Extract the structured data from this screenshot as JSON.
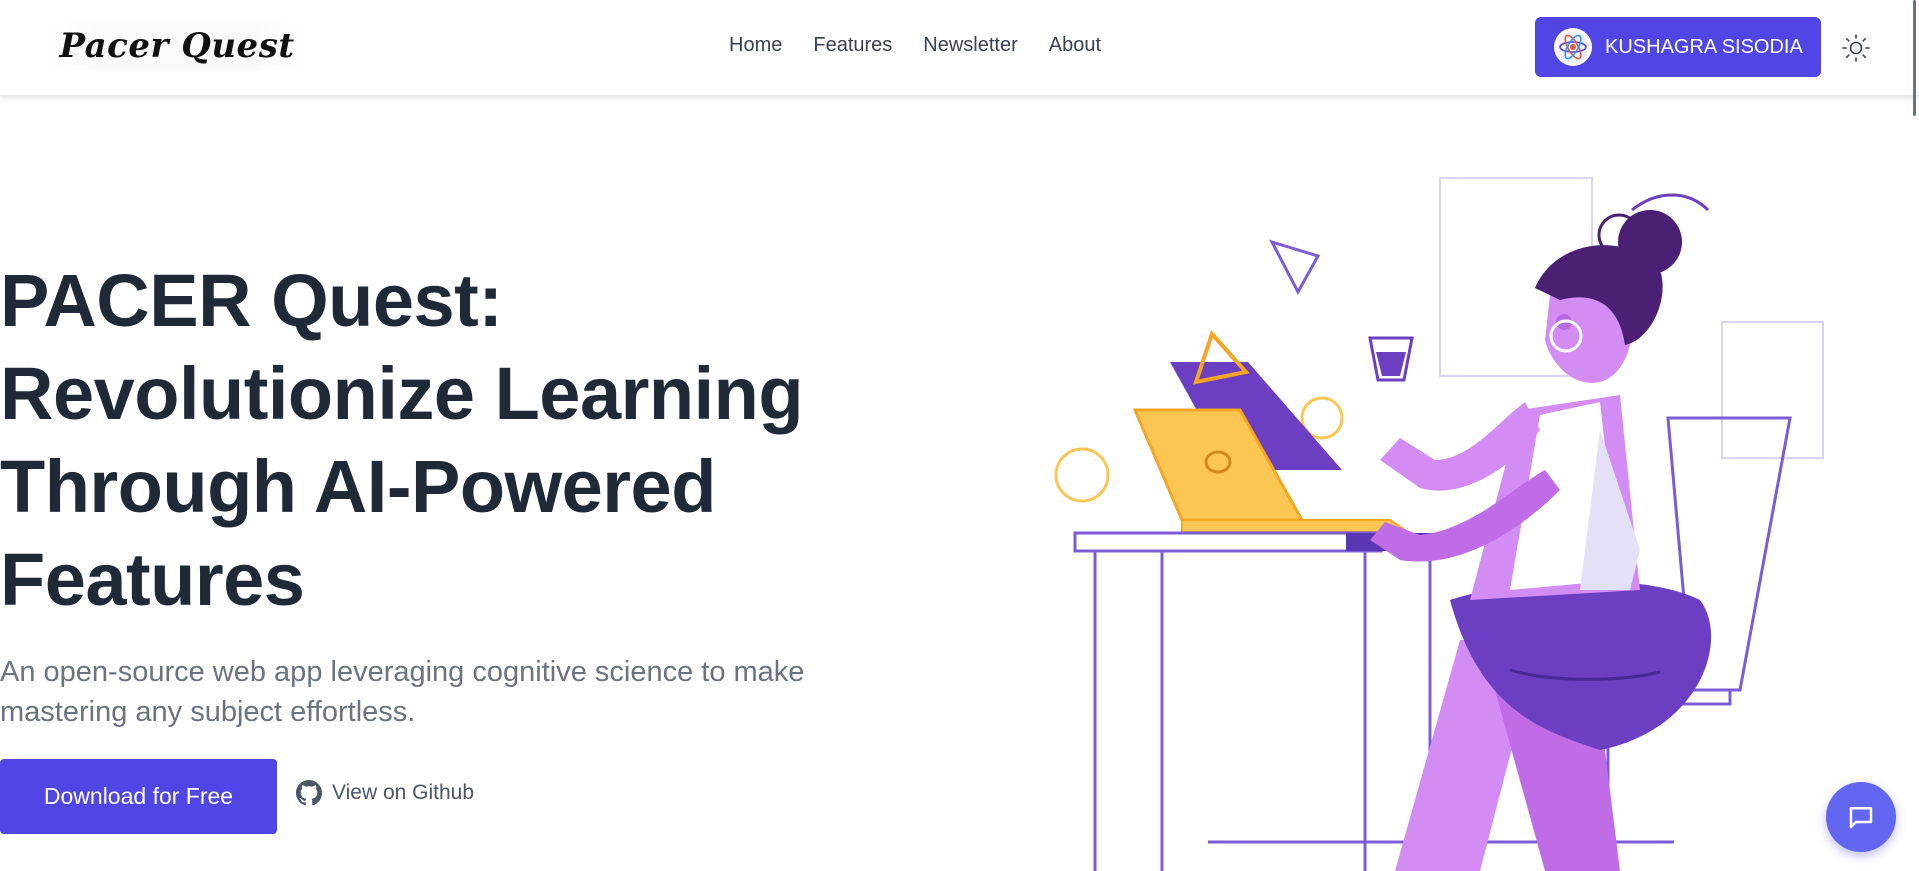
{
  "header": {
    "logo_text": "Pacer Quest",
    "nav": [
      {
        "label": "Home"
      },
      {
        "label": "Features"
      },
      {
        "label": "Newsletter"
      },
      {
        "label": "About"
      }
    ],
    "user_name": "KUSHAGRA SISODIA",
    "theme_icon": "sun-icon"
  },
  "hero": {
    "title": "PACER Quest: Revolutionize Learning Through AI-Powered Features",
    "subtitle": "An open-source web app leveraging cognitive science to make mastering any subject effortless.",
    "primary_button": "Download for Free",
    "github_link": "View on Github"
  },
  "colors": {
    "accent": "#4f46e5",
    "purple_dark": "#6c3ec1",
    "purple_light": "#d48cf5",
    "yellow": "#fcc653",
    "text_dark": "#1f2937",
    "text_muted": "#6b7280"
  },
  "icons": {
    "avatar": "atom-icon",
    "github": "github-icon",
    "chat": "chat-icon"
  }
}
